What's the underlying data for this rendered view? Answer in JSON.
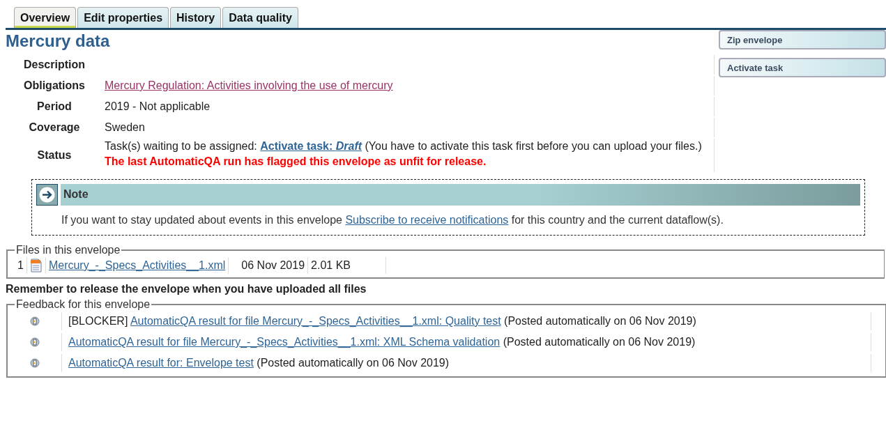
{
  "tabs": [
    {
      "label": "Overview",
      "selected": true
    },
    {
      "label": "Edit properties",
      "selected": false
    },
    {
      "label": "History",
      "selected": false
    },
    {
      "label": "Data quality",
      "selected": false
    }
  ],
  "title": "Mercury data",
  "actions": [
    "Zip envelope",
    "Activate task"
  ],
  "properties": [
    {
      "label": "Description"
    },
    {
      "label": "Obligations",
      "link": "Mercury Regulation: Activities involving the use of mercury"
    },
    {
      "label": "Period",
      "value": "2019 - Not applicable"
    },
    {
      "label": "Coverage",
      "value": "Sweden"
    }
  ],
  "status": {
    "label": "Status",
    "prefix": "Task(s) waiting to be assigned:",
    "link": "Activate task: *Draft*",
    "suffix": "(You have to activate this task first before you can upload your files.)",
    "warning": "The last AutomaticQA run has flagged this envelope as unfit for release."
  },
  "note": {
    "title": "Note",
    "before": "If you want to stay updated about events in this envelope",
    "link": "Subscribe to receive notifications",
    "after": "for this country and the current dataflow(s)."
  },
  "files": {
    "legend": "Files in this envelope",
    "rows": [
      {
        "number": "1",
        "name": "Mercury_-_Specs_Activities__1.xml",
        "date": "06 Nov 2019",
        "size": "2.01 KB"
      }
    ]
  },
  "reminder": "Remember to release the envelope when you have uploaded all files",
  "feedback": {
    "legend": "Feedback for this envelope",
    "items": [
      {
        "tag": "[BLOCKER]",
        "link": "AutomaticQA result for file Mercury_-_Specs_Activities__1.xml: Quality test",
        "posted": "(Posted automatically on 06 Nov 2019)"
      },
      {
        "link": "AutomaticQA result for file Mercury_-_Specs_Activities__1.xml: XML Schema validation",
        "posted": "(Posted automatically on 06 Nov 2019)"
      },
      {
        "link": "AutomaticQA result for: Envelope test",
        "posted": "(Posted automatically on 06 Nov 2019)"
      }
    ]
  }
}
